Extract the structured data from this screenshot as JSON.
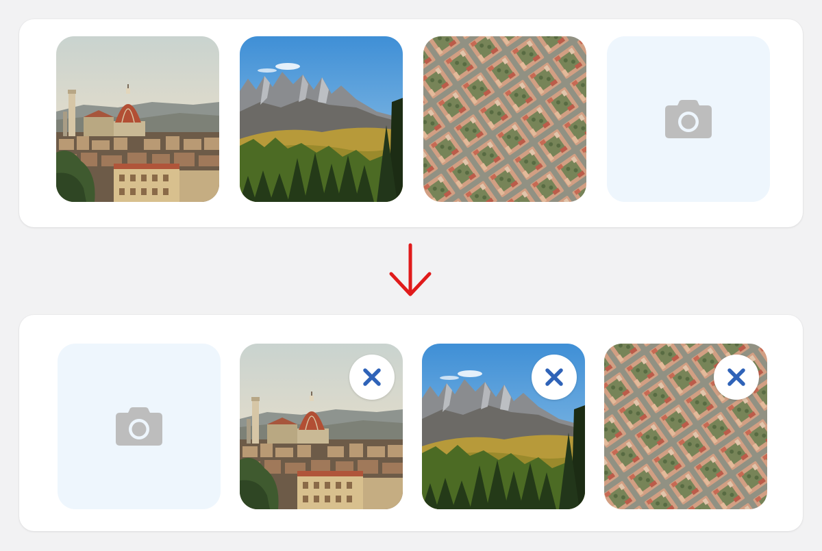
{
  "colors": {
    "panel_bg": "#ffffff",
    "placeholder_bg": "#eef6fd",
    "camera_icon": "#bdbdbd",
    "remove_icon": "#2f63b8",
    "arrow": "#e01b1b"
  },
  "before": {
    "tiles": [
      {
        "type": "photo",
        "subject": "florence-cathedral-skyline"
      },
      {
        "type": "photo",
        "subject": "mountain-meadow"
      },
      {
        "type": "photo",
        "subject": "aerial-city-grid"
      },
      {
        "type": "add-photo",
        "icon": "camera-icon"
      }
    ]
  },
  "transition_icon": "arrow-down-icon",
  "after": {
    "tiles": [
      {
        "type": "add-photo",
        "icon": "camera-icon"
      },
      {
        "type": "photo",
        "subject": "florence-cathedral-skyline",
        "action_icon": "close-icon"
      },
      {
        "type": "photo",
        "subject": "mountain-meadow",
        "action_icon": "close-icon"
      },
      {
        "type": "photo",
        "subject": "aerial-city-grid",
        "action_icon": "close-icon"
      }
    ]
  }
}
